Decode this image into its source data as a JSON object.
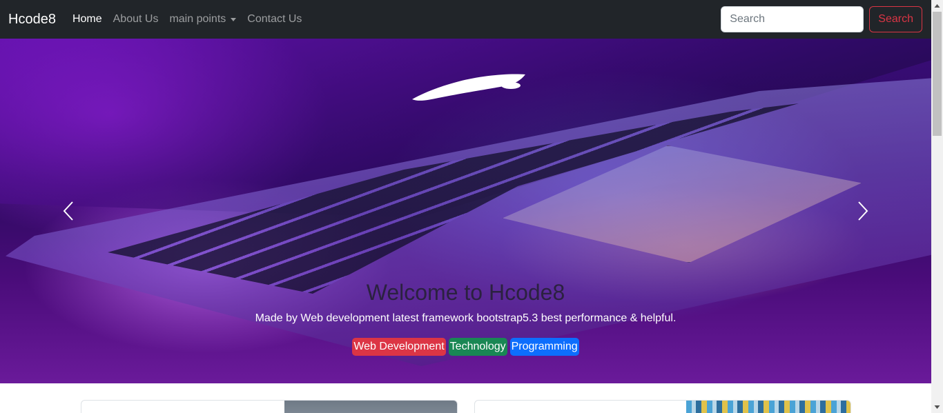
{
  "navbar": {
    "brand": "Hcode8",
    "links": [
      {
        "label": "Home",
        "active": true
      },
      {
        "label": "About Us",
        "active": false
      },
      {
        "label": "main points",
        "dropdown": true
      },
      {
        "label": "Contact Us",
        "active": false
      }
    ],
    "search": {
      "placeholder": "Search",
      "button_label": "Search"
    }
  },
  "carousel": {
    "title": "Welcome to Hcode8",
    "text": "Made by Web development latest framework bootstrap5.3 best performance & helpful.",
    "badges": [
      {
        "label": "Web Development",
        "color": "#dc3545"
      },
      {
        "label": "Technology",
        "color": "#198754"
      },
      {
        "label": "Programming",
        "color": "#0d6efd"
      }
    ],
    "prev_icon": "chevron-left-icon",
    "next_icon": "chevron-right-icon"
  },
  "colors": {
    "navbar_bg": "#212529",
    "accent_danger": "#dc3545"
  }
}
